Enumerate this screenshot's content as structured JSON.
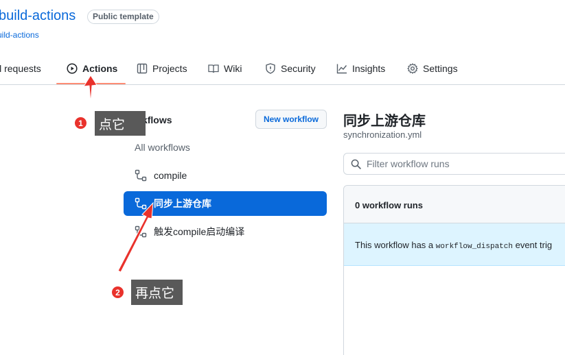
{
  "repo": {
    "name": "build-actions",
    "badge": "Public template",
    "subtitle": "uild-actions"
  },
  "tabs": [
    {
      "label": "ll requests",
      "icon": "pull-request-icon"
    },
    {
      "label": "Actions",
      "icon": "play-icon",
      "active": true
    },
    {
      "label": "Projects",
      "icon": "table-icon"
    },
    {
      "label": "Wiki",
      "icon": "book-icon"
    },
    {
      "label": "Security",
      "icon": "shield-icon"
    },
    {
      "label": "Insights",
      "icon": "graph-icon"
    },
    {
      "label": "Settings",
      "icon": "gear-icon"
    }
  ],
  "sidebar": {
    "heading": "Workflows",
    "new_workflow": "New workflow",
    "items": [
      {
        "label": "All workflows"
      },
      {
        "label": "compile",
        "icon": "workflow-icon"
      },
      {
        "label": "同步上游仓库",
        "icon": "workflow-icon",
        "selected": true
      },
      {
        "label": "触发compile启动编译",
        "icon": "workflow-icon"
      }
    ]
  },
  "main": {
    "title": "同步上游仓库",
    "file": "synchronization.yml",
    "filter_placeholder": "Filter workflow runs",
    "runs_count": "0 workflow runs",
    "info_prefix": "This workflow has a ",
    "info_code": "workflow_dispatch",
    "info_suffix": " event trig"
  },
  "annotations": {
    "step1_number": "1",
    "step1_text": "点它",
    "step2_number": "2",
    "step2_text": "再点它"
  },
  "colors": {
    "accent": "#0969da",
    "tab_underline": "#fd8c73",
    "annotation_red": "#e9322c",
    "callout_bg": "#595959"
  }
}
